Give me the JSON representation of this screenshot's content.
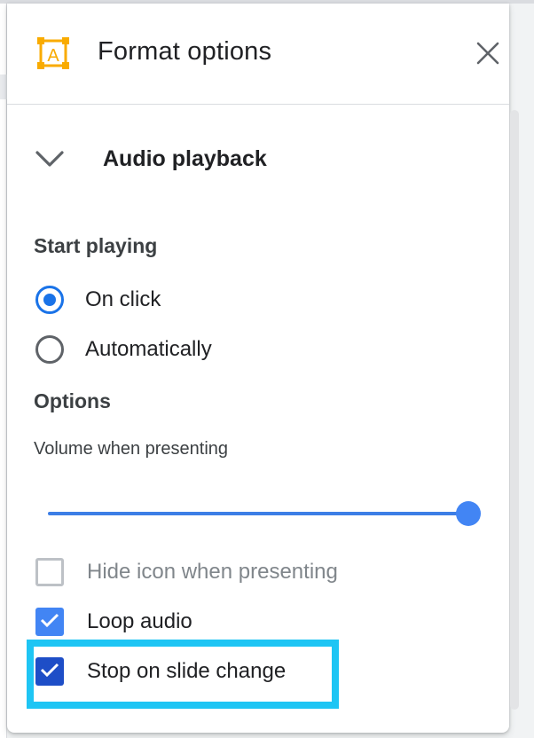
{
  "panel": {
    "title": "Format options",
    "header_icon": "text-box-icon",
    "close_icon": "close-icon"
  },
  "section": {
    "title": "Audio playback",
    "expanded": true
  },
  "start_playing": {
    "label": "Start playing",
    "options": [
      {
        "label": "On click",
        "checked": true
      },
      {
        "label": "Automatically",
        "checked": false
      }
    ]
  },
  "options": {
    "label": "Options",
    "volume_label": "Volume when presenting",
    "volume_fraction": 1.0,
    "checkboxes": [
      {
        "label": "Hide icon when presenting",
        "checked": false,
        "disabled": true
      },
      {
        "label": "Loop audio",
        "checked": true
      },
      {
        "label": "Stop on slide change",
        "checked": true,
        "highlighted": true
      }
    ]
  },
  "colors": {
    "accent": "#1a73e8",
    "checkbox_light": "#4285f4",
    "checkbox_dark": "#1e4ec7",
    "highlight": "#1ec5f4",
    "icon_orange": "#f9ab00"
  }
}
